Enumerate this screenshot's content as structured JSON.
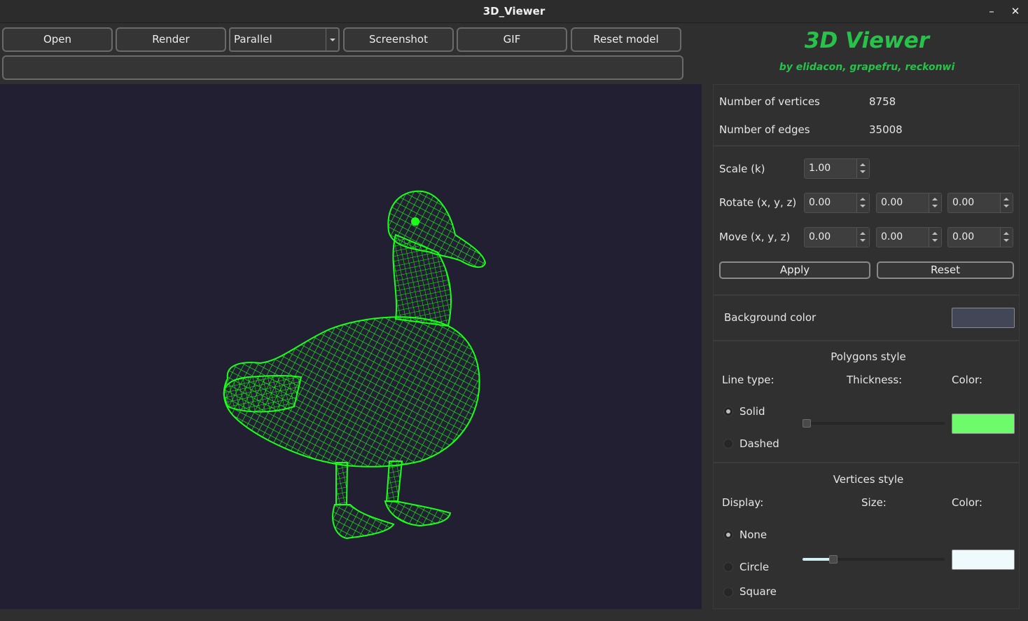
{
  "window": {
    "title": "3D_Viewer",
    "minimize": "–",
    "close": "✕"
  },
  "toolbar": {
    "open": "Open",
    "render": "Render",
    "projection": "Parallel",
    "screenshot": "Screenshot",
    "gif": "GIF",
    "reset_model": "Reset model"
  },
  "file_path": {
    "value": ""
  },
  "brand": {
    "title": "3D Viewer",
    "subtitle": "by elidacon, grapefru, reckonwi",
    "color": "#27c24a"
  },
  "viewport": {
    "background": "#221f32",
    "model_color": "#1aff1a"
  },
  "info": {
    "vertices_label": "Number of vertices",
    "vertices_value": "8758",
    "edges_label": "Number of edges",
    "edges_value": "35008"
  },
  "transform": {
    "scale_label": "Scale (k)",
    "scale": "1.00",
    "rotate_label": "Rotate (x, y, z)",
    "rotate": [
      "0.00",
      "0.00",
      "0.00"
    ],
    "move_label": "Move (x, y, z)",
    "move": [
      "0.00",
      "0.00",
      "0.00"
    ],
    "apply": "Apply",
    "reset": "Reset"
  },
  "background": {
    "label": "Background color",
    "color": "#434656"
  },
  "polygons": {
    "heading": "Polygons style",
    "line_type_label": "Line type:",
    "thickness_label": "Thickness:",
    "color_label": "Color:",
    "options": [
      "Solid",
      "Dashed"
    ],
    "selected": "Solid",
    "thickness_level": 0.0,
    "color": "#6dfa6b"
  },
  "vertices": {
    "heading": "Vertices style",
    "display_label": "Display:",
    "size_label": "Size:",
    "color_label": "Color:",
    "options": [
      "None",
      "Circle",
      "Square"
    ],
    "selected": "None",
    "size_level": 0.2,
    "color": "#eefafc"
  }
}
